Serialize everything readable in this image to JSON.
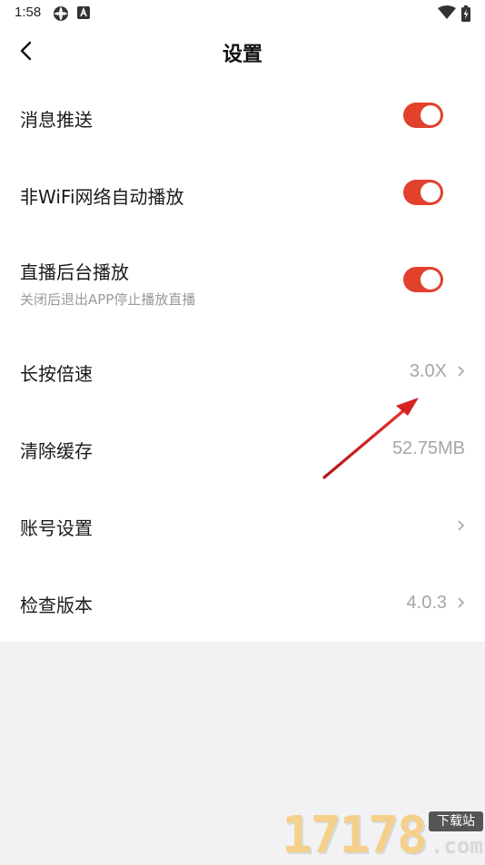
{
  "status_bar": {
    "time": "1:58",
    "icons": [
      "settings-gear-icon",
      "a-badge-icon",
      "wifi-icon",
      "battery-charging-icon"
    ]
  },
  "header": {
    "title": "设置",
    "back_icon": "chevron-left-icon"
  },
  "settings": [
    {
      "label": "消息推送",
      "type": "toggle",
      "on": true
    },
    {
      "label": "非WiFi网络自动播放",
      "type": "toggle",
      "on": true
    },
    {
      "label": "直播后台播放",
      "subtitle": "关闭后退出APP停止播放直播",
      "type": "toggle",
      "on": true
    },
    {
      "label": "长按倍速",
      "type": "value-link",
      "value": "3.0X"
    },
    {
      "label": "清除缓存",
      "type": "value",
      "value": "52.75MB"
    },
    {
      "label": "账号设置",
      "type": "link"
    },
    {
      "label": "检查版本",
      "type": "value-link",
      "value": "4.0.3"
    }
  ],
  "colors": {
    "toggle_on": "#e2412b",
    "annotation_arrow": "#d62222",
    "value_text": "#a6a6a6"
  },
  "watermark": {
    "digits": "17178",
    "tag": "下载站",
    "suffix": ".com"
  }
}
